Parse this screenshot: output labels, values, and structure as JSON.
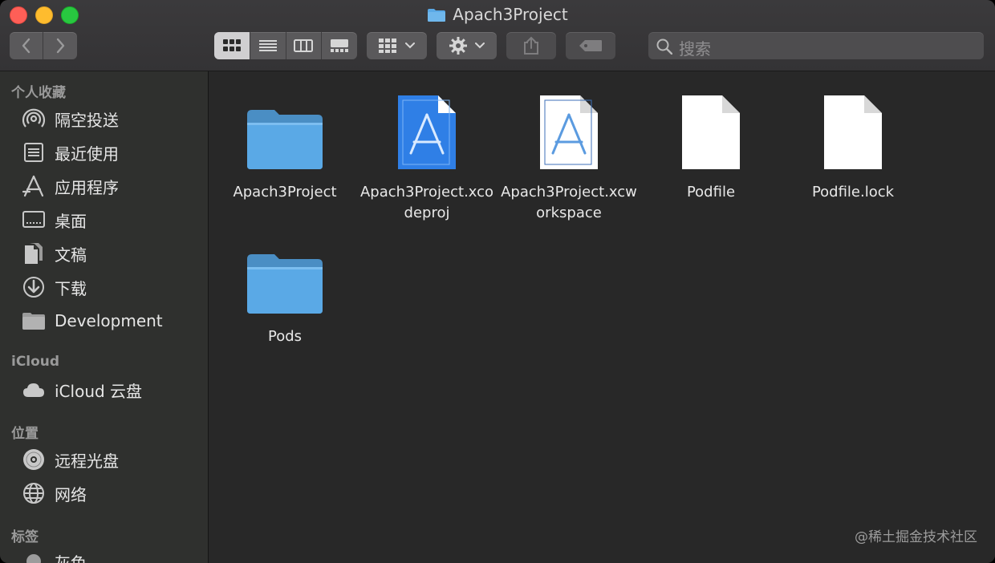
{
  "window": {
    "title": "Apach3Project"
  },
  "toolbar": {
    "back_label": "back",
    "forward_label": "forward",
    "view_modes": [
      "icon-view",
      "list-view",
      "column-view",
      "gallery-view"
    ],
    "active_view": "icon-view"
  },
  "search": {
    "placeholder": "搜索"
  },
  "sidebar": {
    "favorites_title": "个人收藏",
    "favorites": [
      {
        "label": "隔空投送",
        "icon": "airdrop-icon"
      },
      {
        "label": "最近使用",
        "icon": "recents-icon"
      },
      {
        "label": "应用程序",
        "icon": "applications-icon"
      },
      {
        "label": "桌面",
        "icon": "desktop-icon"
      },
      {
        "label": "文稿",
        "icon": "documents-icon"
      },
      {
        "label": "下载",
        "icon": "downloads-icon"
      },
      {
        "label": "Development",
        "icon": "folder-icon"
      }
    ],
    "icloud_title": "iCloud",
    "icloud": [
      {
        "label": "iCloud 云盘",
        "icon": "cloud-icon"
      }
    ],
    "locations_title": "位置",
    "locations": [
      {
        "label": "远程光盘",
        "icon": "disc-icon"
      },
      {
        "label": "网络",
        "icon": "network-icon"
      }
    ],
    "tags_title": "标签",
    "tags": [
      {
        "label": "灰色",
        "color": "#9c9c9c"
      }
    ]
  },
  "files": [
    {
      "name": "Apach3Project",
      "kind": "folder"
    },
    {
      "name": "Apach3Project.xcodeproj",
      "kind": "xcodeproj"
    },
    {
      "name": "Apach3Project.xcworkspace",
      "kind": "xcworkspace"
    },
    {
      "name": "Podfile",
      "kind": "document"
    },
    {
      "name": "Podfile.lock",
      "kind": "document"
    },
    {
      "name": "Pods",
      "kind": "folder"
    }
  ],
  "watermark": "@稀土掘金技术社区",
  "colors": {
    "accent_folder": "#5aa9e6",
    "close": "#fe5f57",
    "minimize": "#febc2e",
    "maximize": "#28c840"
  }
}
